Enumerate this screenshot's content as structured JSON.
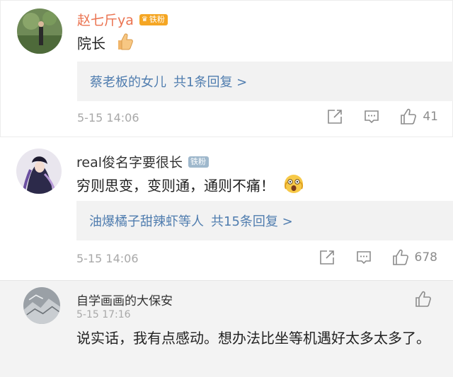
{
  "comments": [
    {
      "username": "赵七斤ya",
      "badge": "铁粉",
      "text": "院长",
      "reply": {
        "names": "蔡老板的女儿",
        "count_text": "共1条回复 >"
      },
      "time": "5-15 14:06",
      "likes": "41"
    },
    {
      "username": "real俊名字要很长",
      "badge": "铁粉",
      "text": "穷则思变，变则通，通则不痛！",
      "reply": {
        "names": "油爆橘子甜辣虾等人",
        "count_text": "共15条回复 >"
      },
      "time": "5-15 14:06",
      "likes": "678"
    },
    {
      "username": "自学画画的大保安",
      "time": "5-15 17:16",
      "text": "说实话，我有点感动。想办法比坐等机遇好太多太多了。"
    }
  ],
  "colors": {
    "username_highlight": "#eb7350",
    "link": "#507daf",
    "badge_gold": "#f5a623",
    "badge_blue": "#9fb8cc",
    "meta": "#a8a8a8"
  },
  "icons": [
    "thumbs-up-emoji",
    "shocked-face-emoji",
    "share-icon",
    "comment-icon",
    "like-icon"
  ]
}
